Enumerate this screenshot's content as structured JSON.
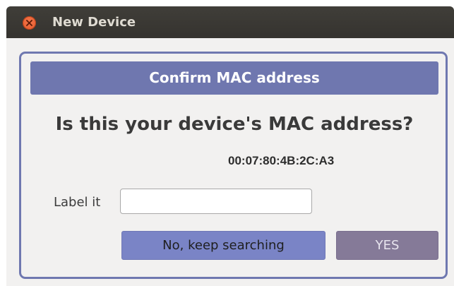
{
  "window": {
    "title": "New Device"
  },
  "dialog": {
    "header": "Confirm MAC address",
    "question": "Is this your device's MAC address?",
    "mac_address": "00:07:80:4B:2C:A3",
    "label_field": {
      "label": "Label it",
      "value": "",
      "placeholder": ""
    },
    "buttons": {
      "no_label": "No, keep searching",
      "yes_label": "YES"
    }
  },
  "icons": {
    "close": "close-icon"
  },
  "colors": {
    "titlebar": "#3c3b37",
    "close_button": "#e95420",
    "accent": "#6f77af",
    "no_button": "#7a84c6",
    "yes_button": "#857a98",
    "window_bg": "#f2f1f0"
  }
}
